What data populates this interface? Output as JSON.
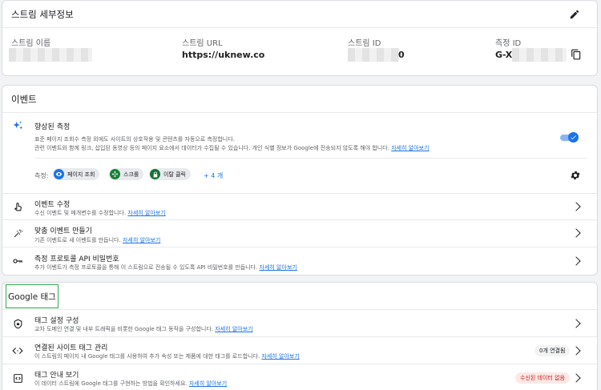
{
  "stream_details": {
    "title": "스트림 세부정보",
    "name_label": "스트림 이름",
    "url_label": "스트림 URL",
    "url_value": "https://uknew.co",
    "id_label": "스트림 ID",
    "id_value_suffix": "0",
    "measurement_label": "측정 ID",
    "measurement_value_prefix": "G-X"
  },
  "events": {
    "title": "이벤트",
    "enhanced": {
      "title": "향상된 측정",
      "desc1": "표준 페이지 조회수 측정 외에도 사이트의 상호작용 및 콘텐츠를 자동으로 측정합니다.",
      "desc2": "관련 이벤트와 함께 링크, 삽입된 동영상 등의 페이지 요소에서 데이터가 수집될 수 있습니다. 개인 식별 정보가 Google에 전송되지 않도록 해야 합니다.",
      "link": "자세히 알아보기",
      "measure_label": "측정:",
      "chips": [
        "페이지 조회",
        "스크롤",
        "이탈 클릭"
      ],
      "more": "+ 4 개"
    },
    "rows": [
      {
        "title": "이벤트 수정",
        "desc": "수신 이벤트 및 매개변수를 수정합니다.",
        "link": "자세히 알아보기"
      },
      {
        "title": "맞춤 이벤트 만들기",
        "desc": "기존 이벤트로 새 이벤트를 만듭니다.",
        "link": "자세히 알아보기"
      },
      {
        "title": "측정 프로토콜 API 비밀번호",
        "desc": "추가 이벤트가 측정 프로토콜을 통해 이 스트림으로 전송될 수 있도록 API 비밀번호를 만듭니다.",
        "link": "자세히 알아보기"
      }
    ]
  },
  "google_tag": {
    "title": "Google 태그",
    "rows": [
      {
        "title": "태그 설정 구성",
        "desc": "교차 도메인 연결 및 내부 트래픽을 비롯한 Google 태그 동작을 구성합니다.",
        "link": "자세히 알아보기"
      },
      {
        "title": "연결된 사이트 태그 관리",
        "desc": "이 스트림의 페이지 내 Google 태그를 사용하여 추가 속성 또는 제품에 대한 태그를 로드합니다.",
        "link": "자세히 알아보기",
        "badge": "0개 연결됨"
      },
      {
        "title": "태그 안내 보기",
        "desc": "이 데이터 스트림에 Google 태그를 구현하는 방법을 확인하세요.",
        "link": "자세히 알아보기",
        "badge": "수신된 데이터 없음"
      }
    ]
  },
  "colors": {
    "accent": "#1a73e8",
    "highlight_box": "#34a853",
    "warn_bg": "#fce8e6",
    "warn_text": "#c5221f"
  }
}
